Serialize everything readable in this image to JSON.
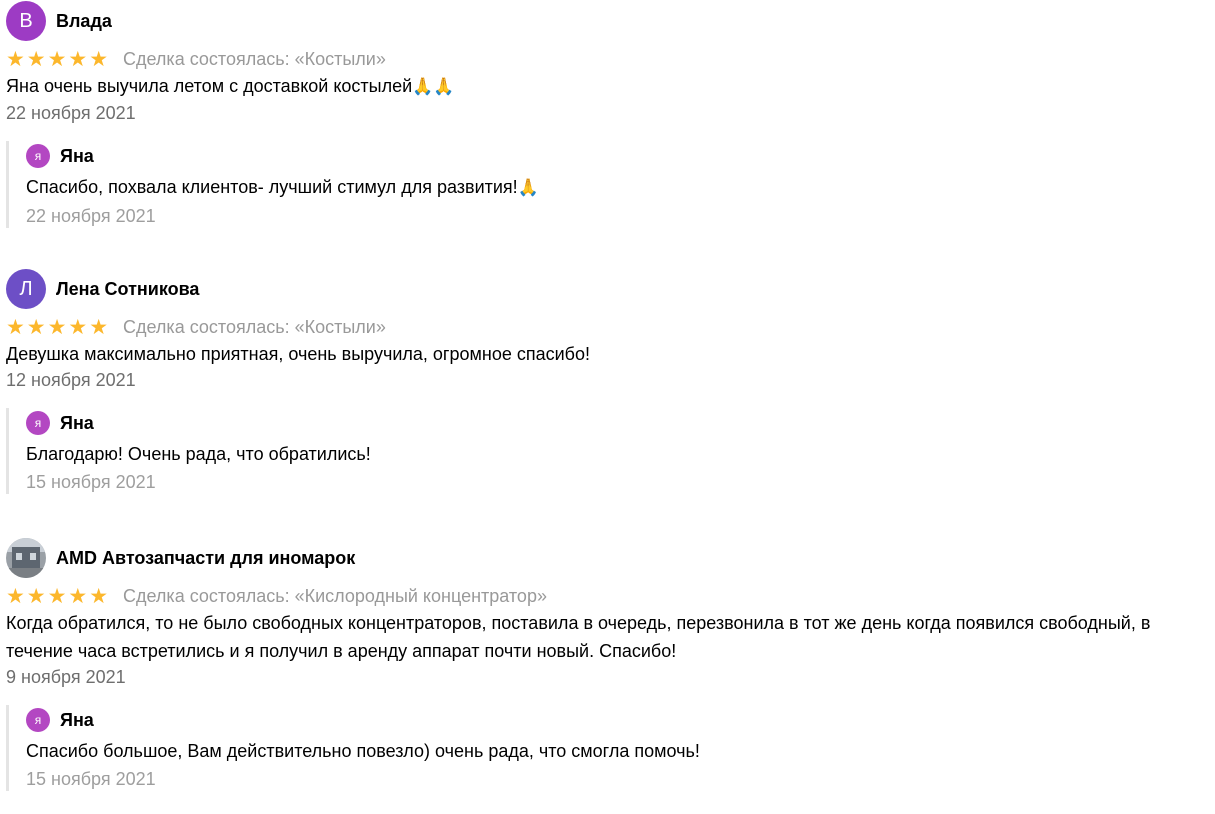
{
  "icons": {
    "star": "star-icon",
    "star_color": "#fcb72c",
    "praying_hands": "praying-hands-icon"
  },
  "reviews": [
    {
      "author": "Влада",
      "avatar_letter": "В",
      "avatar_color": "#9d3bc4",
      "rating": 5,
      "deal": "Сделка состоялась: «Костыли»",
      "text": "Яна очень выучила летом с доставкой костылей",
      "text_emoji": "🙏🙏",
      "date": "22 ноября 2021",
      "reply": {
        "author": "Яна",
        "avatar_letter": "я",
        "text": "Спасибо, похвала клиентов- лучший стимул для развития!",
        "text_emoji": "🙏",
        "date": "22 ноября 2021"
      }
    },
    {
      "author": "Лена Сотникова",
      "avatar_letter": "Л",
      "avatar_color": "#6d4fc6",
      "rating": 5,
      "deal": "Сделка состоялась: «Костыли»",
      "text": "Девушка максимально приятная, очень выручила, огромное спасибо!",
      "date": "12 ноября 2021",
      "reply": {
        "author": "Яна",
        "avatar_letter": "я",
        "text": "Благодарю! Очень рада, что обратились!",
        "date": "15 ноября 2021"
      }
    },
    {
      "author": "AMD Автозапчасти для иномарок",
      "avatar_type": "photo",
      "rating": 5,
      "deal": "Сделка состоялась: «Кислородный концентратор»",
      "text": "Когда обратился, то не было свободных концентраторов, поставила в очередь, перезвонила в тот же день когда появился свободный, в течение часа встретились и я получил в аренду аппарат почти новый. Спасибо!",
      "date": "9 ноября 2021",
      "reply": {
        "author": "Яна",
        "avatar_letter": "я",
        "text": "Спасибо большое, Вам действительно повезло) очень рада, что смогла помочь!",
        "date": "15 ноября 2021"
      }
    }
  ]
}
